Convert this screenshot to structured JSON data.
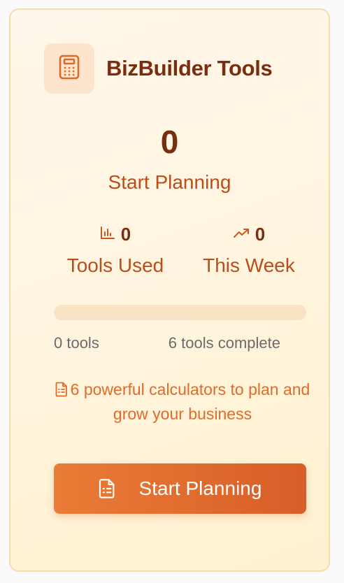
{
  "brand": {
    "name": "BizBuilder Tools",
    "logo_icon": "calculator-icon"
  },
  "summary": {
    "count": "0",
    "label": "Start Planning"
  },
  "stats": [
    {
      "icon": "bar-chart-icon",
      "value": "0",
      "label": "Tools Used"
    },
    {
      "icon": "trending-up-icon",
      "value": "0",
      "label": "This Week"
    }
  ],
  "progress": {
    "fraction": 0,
    "left_text": "0 tools",
    "right_text": "6 tools complete"
  },
  "description": {
    "icon": "document-icon",
    "text": "6 powerful calculators to plan and grow your business"
  },
  "cta": {
    "label": "Start Planning",
    "icon": "document-icon"
  },
  "colors": {
    "accent": "#e3702d",
    "heading": "#7a2e10",
    "label": "#b94e1a",
    "card_border": "#f6dcaa"
  }
}
